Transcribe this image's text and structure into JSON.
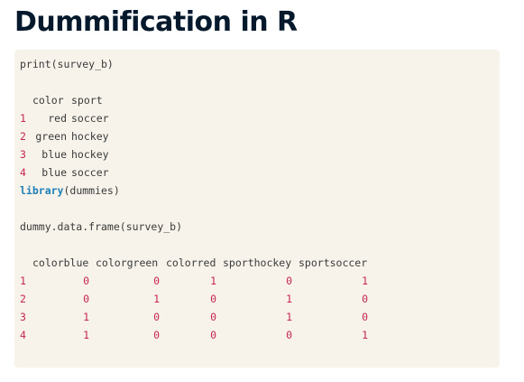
{
  "title": "Dummification in R",
  "code": {
    "print_cmd": "print(survey_b)",
    "table1": {
      "headers": [
        "color",
        "sport"
      ],
      "rows": [
        {
          "index": "1",
          "color": "red",
          "sport": "soccer"
        },
        {
          "index": "2",
          "color": "green",
          "sport": "hockey"
        },
        {
          "index": "3",
          "color": "blue",
          "sport": "hockey"
        },
        {
          "index": "4",
          "color": "blue",
          "sport": "soccer"
        }
      ]
    },
    "library_keyword": "library",
    "library_args": "(dummies)",
    "dummy_cmd": "dummy.data.frame(survey_b)",
    "table2": {
      "headers": [
        "colorblue",
        "colorgreen",
        "colorred",
        "sporthockey",
        "sportsoccer"
      ],
      "rows": [
        {
          "index": "1",
          "values": [
            "0",
            "0",
            "1",
            "0",
            "1"
          ]
        },
        {
          "index": "2",
          "values": [
            "0",
            "1",
            "0",
            "1",
            "0"
          ]
        },
        {
          "index": "3",
          "values": [
            "1",
            "0",
            "0",
            "1",
            "0"
          ]
        },
        {
          "index": "4",
          "values": [
            "1",
            "0",
            "0",
            "0",
            "1"
          ]
        }
      ]
    }
  },
  "colors": {
    "title": "#05192d",
    "panel_background": "#f7f3eb",
    "code_text": "#3a3a3a",
    "numbers": "#c7254e",
    "keyword": "#1d7fb5"
  }
}
